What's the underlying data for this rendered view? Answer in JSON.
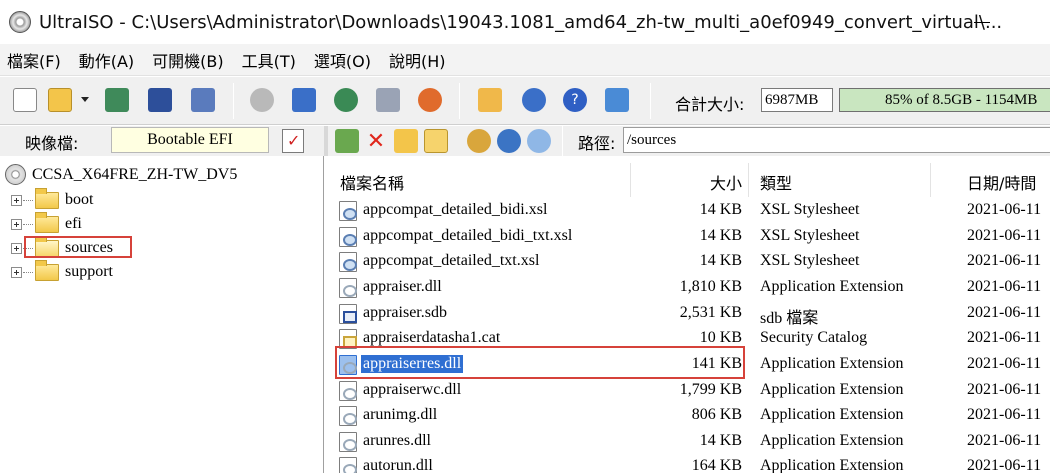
{
  "window": {
    "title": "UltraISO - C:\\Users\\Administrator\\Downloads\\19043.1081_amd64_zh-tw_multi_a0ef0949_convert_virtual\\..."
  },
  "menu": [
    "檔案(F)",
    "動作(A)",
    "可開機(B)",
    "工具(T)",
    "選項(O)",
    "說明(H)"
  ],
  "toolbar": {
    "total_label": "合計大小:",
    "total_size": "6987MB",
    "capacity": "85% of 8.5GB - 1154MB"
  },
  "image_bar": {
    "label": "映像檔:",
    "type": "Bootable EFI",
    "path_label": "路徑:",
    "path": "/sources"
  },
  "tree": {
    "root": "CCSA_X64FRE_ZH-TW_DV5",
    "nodes": [
      "boot",
      "efi",
      "sources",
      "support"
    ]
  },
  "file_list": {
    "columns": [
      "檔案名稱",
      "大小",
      "類型",
      "日期/時間"
    ],
    "rows": [
      {
        "name": "appcompat_detailed_bidi.xsl",
        "size": "14 KB",
        "type": "XSL Stylesheet",
        "date": "2021-06-11"
      },
      {
        "name": "appcompat_detailed_bidi_txt.xsl",
        "size": "14 KB",
        "type": "XSL Stylesheet",
        "date": "2021-06-11"
      },
      {
        "name": "appcompat_detailed_txt.xsl",
        "size": "14 KB",
        "type": "XSL Stylesheet",
        "date": "2021-06-11"
      },
      {
        "name": "appraiser.dll",
        "size": "1,810 KB",
        "type": "Application Extension",
        "date": "2021-06-11"
      },
      {
        "name": "appraiser.sdb",
        "size": "2,531 KB",
        "type": "sdb 檔案",
        "date": "2021-06-11"
      },
      {
        "name": "appraiserdatasha1.cat",
        "size": "10 KB",
        "type": "Security Catalog",
        "date": "2021-06-11"
      },
      {
        "name": "appraiserres.dll",
        "size": "141 KB",
        "type": "Application Extension",
        "date": "2021-06-11"
      },
      {
        "name": "appraiserwc.dll",
        "size": "1,799 KB",
        "type": "Application Extension",
        "date": "2021-06-11"
      },
      {
        "name": "arunimg.dll",
        "size": "806 KB",
        "type": "Application Extension",
        "date": "2021-06-11"
      },
      {
        "name": "arunres.dll",
        "size": "14 KB",
        "type": "Application Extension",
        "date": "2021-06-11"
      },
      {
        "name": "autorun.dll",
        "size": "164 KB",
        "type": "Application Extension",
        "date": "2021-06-11"
      }
    ]
  },
  "colors": {
    "highlight_box": "#d6423a",
    "selection": "#2f6fd2",
    "capacity_bar": "#c9e6c0",
    "image_type_bg": "#ffffe1"
  }
}
